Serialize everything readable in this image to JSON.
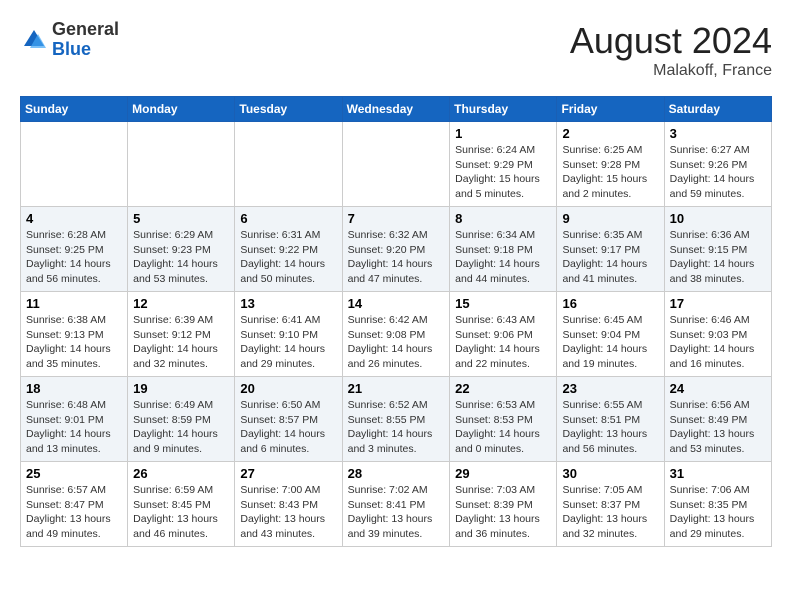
{
  "header": {
    "logo_general": "General",
    "logo_blue": "Blue",
    "title": "August 2024",
    "subtitle": "Malakoff, France"
  },
  "days_of_week": [
    "Sunday",
    "Monday",
    "Tuesday",
    "Wednesday",
    "Thursday",
    "Friday",
    "Saturday"
  ],
  "weeks": [
    [
      {
        "day": "",
        "info": ""
      },
      {
        "day": "",
        "info": ""
      },
      {
        "day": "",
        "info": ""
      },
      {
        "day": "",
        "info": ""
      },
      {
        "day": "1",
        "info": "Sunrise: 6:24 AM\nSunset: 9:29 PM\nDaylight: 15 hours\nand 5 minutes."
      },
      {
        "day": "2",
        "info": "Sunrise: 6:25 AM\nSunset: 9:28 PM\nDaylight: 15 hours\nand 2 minutes."
      },
      {
        "day": "3",
        "info": "Sunrise: 6:27 AM\nSunset: 9:26 PM\nDaylight: 14 hours\nand 59 minutes."
      }
    ],
    [
      {
        "day": "4",
        "info": "Sunrise: 6:28 AM\nSunset: 9:25 PM\nDaylight: 14 hours\nand 56 minutes."
      },
      {
        "day": "5",
        "info": "Sunrise: 6:29 AM\nSunset: 9:23 PM\nDaylight: 14 hours\nand 53 minutes."
      },
      {
        "day": "6",
        "info": "Sunrise: 6:31 AM\nSunset: 9:22 PM\nDaylight: 14 hours\nand 50 minutes."
      },
      {
        "day": "7",
        "info": "Sunrise: 6:32 AM\nSunset: 9:20 PM\nDaylight: 14 hours\nand 47 minutes."
      },
      {
        "day": "8",
        "info": "Sunrise: 6:34 AM\nSunset: 9:18 PM\nDaylight: 14 hours\nand 44 minutes."
      },
      {
        "day": "9",
        "info": "Sunrise: 6:35 AM\nSunset: 9:17 PM\nDaylight: 14 hours\nand 41 minutes."
      },
      {
        "day": "10",
        "info": "Sunrise: 6:36 AM\nSunset: 9:15 PM\nDaylight: 14 hours\nand 38 minutes."
      }
    ],
    [
      {
        "day": "11",
        "info": "Sunrise: 6:38 AM\nSunset: 9:13 PM\nDaylight: 14 hours\nand 35 minutes."
      },
      {
        "day": "12",
        "info": "Sunrise: 6:39 AM\nSunset: 9:12 PM\nDaylight: 14 hours\nand 32 minutes."
      },
      {
        "day": "13",
        "info": "Sunrise: 6:41 AM\nSunset: 9:10 PM\nDaylight: 14 hours\nand 29 minutes."
      },
      {
        "day": "14",
        "info": "Sunrise: 6:42 AM\nSunset: 9:08 PM\nDaylight: 14 hours\nand 26 minutes."
      },
      {
        "day": "15",
        "info": "Sunrise: 6:43 AM\nSunset: 9:06 PM\nDaylight: 14 hours\nand 22 minutes."
      },
      {
        "day": "16",
        "info": "Sunrise: 6:45 AM\nSunset: 9:04 PM\nDaylight: 14 hours\nand 19 minutes."
      },
      {
        "day": "17",
        "info": "Sunrise: 6:46 AM\nSunset: 9:03 PM\nDaylight: 14 hours\nand 16 minutes."
      }
    ],
    [
      {
        "day": "18",
        "info": "Sunrise: 6:48 AM\nSunset: 9:01 PM\nDaylight: 14 hours\nand 13 minutes."
      },
      {
        "day": "19",
        "info": "Sunrise: 6:49 AM\nSunset: 8:59 PM\nDaylight: 14 hours\nand 9 minutes."
      },
      {
        "day": "20",
        "info": "Sunrise: 6:50 AM\nSunset: 8:57 PM\nDaylight: 14 hours\nand 6 minutes."
      },
      {
        "day": "21",
        "info": "Sunrise: 6:52 AM\nSunset: 8:55 PM\nDaylight: 14 hours\nand 3 minutes."
      },
      {
        "day": "22",
        "info": "Sunrise: 6:53 AM\nSunset: 8:53 PM\nDaylight: 14 hours\nand 0 minutes."
      },
      {
        "day": "23",
        "info": "Sunrise: 6:55 AM\nSunset: 8:51 PM\nDaylight: 13 hours\nand 56 minutes."
      },
      {
        "day": "24",
        "info": "Sunrise: 6:56 AM\nSunset: 8:49 PM\nDaylight: 13 hours\nand 53 minutes."
      }
    ],
    [
      {
        "day": "25",
        "info": "Sunrise: 6:57 AM\nSunset: 8:47 PM\nDaylight: 13 hours\nand 49 minutes."
      },
      {
        "day": "26",
        "info": "Sunrise: 6:59 AM\nSunset: 8:45 PM\nDaylight: 13 hours\nand 46 minutes."
      },
      {
        "day": "27",
        "info": "Sunrise: 7:00 AM\nSunset: 8:43 PM\nDaylight: 13 hours\nand 43 minutes."
      },
      {
        "day": "28",
        "info": "Sunrise: 7:02 AM\nSunset: 8:41 PM\nDaylight: 13 hours\nand 39 minutes."
      },
      {
        "day": "29",
        "info": "Sunrise: 7:03 AM\nSunset: 8:39 PM\nDaylight: 13 hours\nand 36 minutes."
      },
      {
        "day": "30",
        "info": "Sunrise: 7:05 AM\nSunset: 8:37 PM\nDaylight: 13 hours\nand 32 minutes."
      },
      {
        "day": "31",
        "info": "Sunrise: 7:06 AM\nSunset: 8:35 PM\nDaylight: 13 hours\nand 29 minutes."
      }
    ]
  ]
}
